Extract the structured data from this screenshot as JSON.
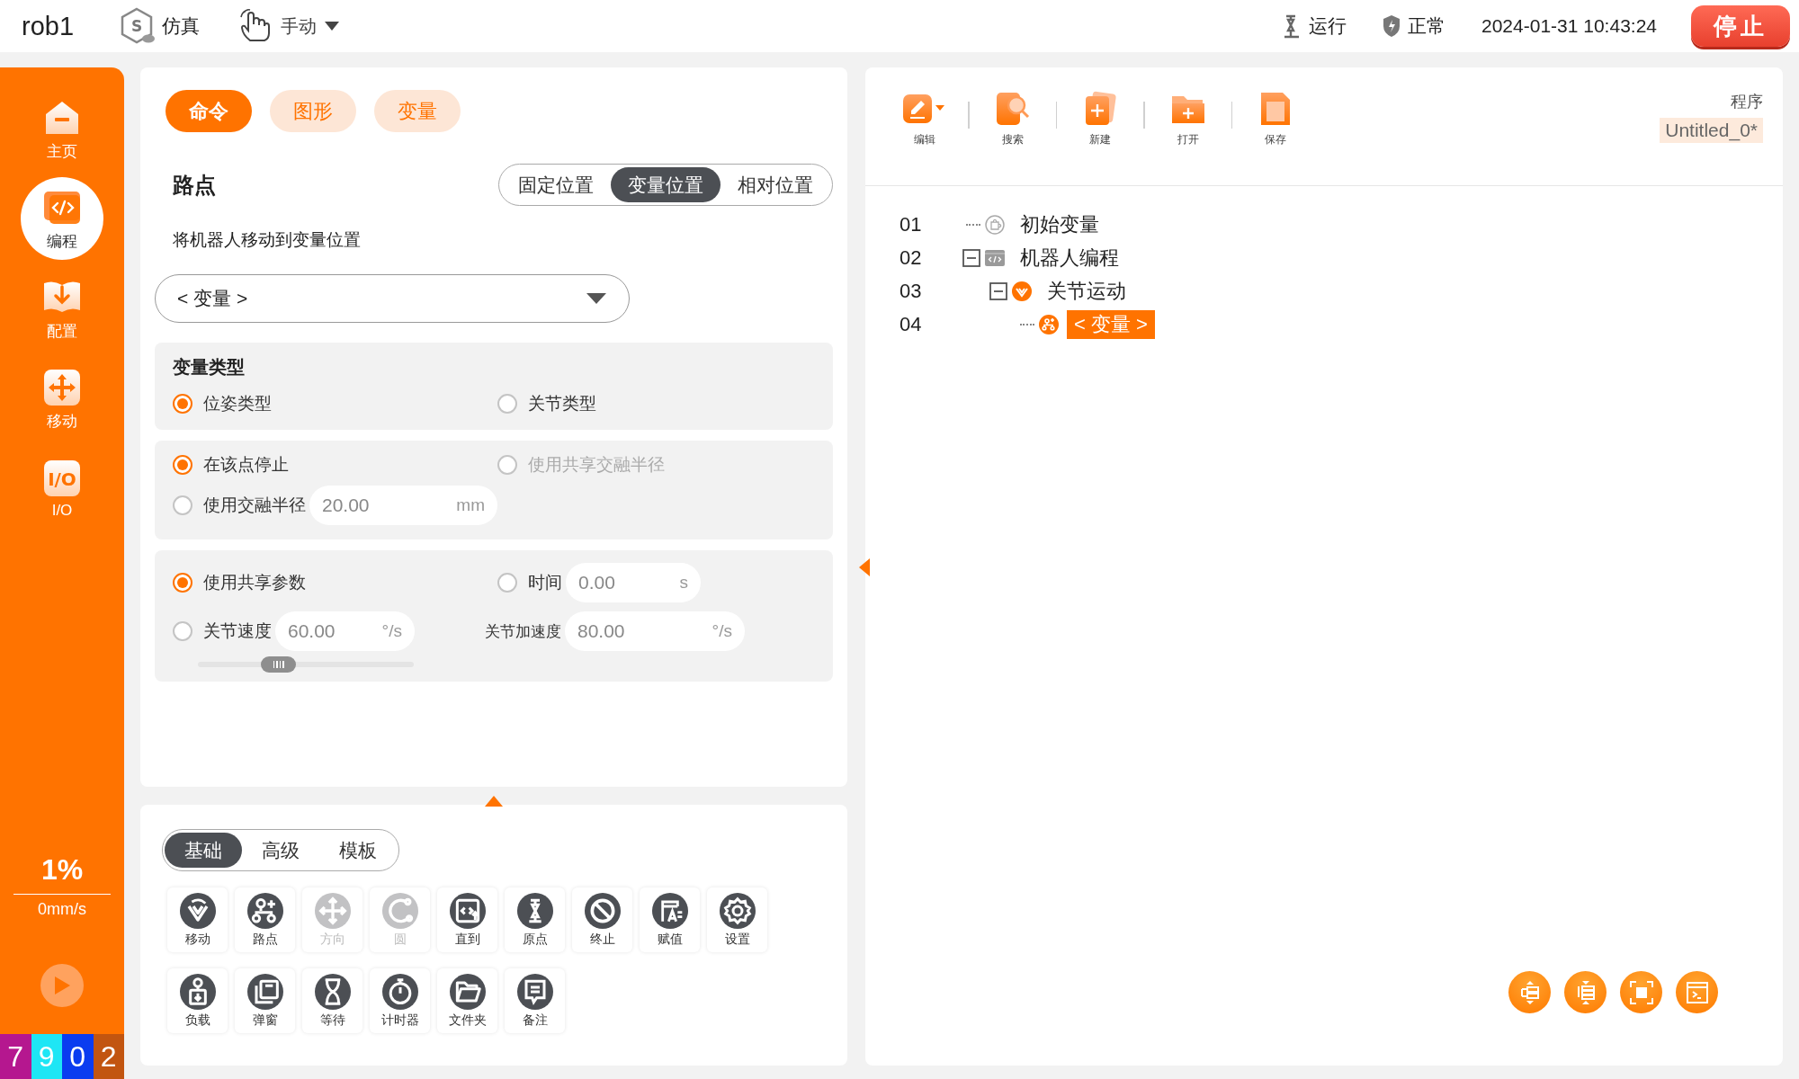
{
  "header": {
    "robot": "rob1",
    "mode": {
      "icon_text": "S",
      "label": "仿真"
    },
    "control": {
      "label": "手动"
    },
    "status": [
      {
        "kind": "robot",
        "label": "运行"
      },
      {
        "kind": "shield",
        "label": "正常"
      }
    ],
    "datetime": "2024-01-31 10:43:24",
    "stop_button": "停止"
  },
  "sidebar": {
    "items": [
      {
        "kind": "home",
        "label": "主页",
        "selected": false
      },
      {
        "kind": "code",
        "label": "编程",
        "selected": true
      },
      {
        "kind": "config",
        "label": "配置",
        "selected": false
      },
      {
        "kind": "move",
        "label": "移动",
        "selected": false
      },
      {
        "kind": "io",
        "label": "I/O",
        "icon_text": "I/O",
        "selected": false
      }
    ],
    "speed": "1%",
    "velocity": "0mm/s",
    "counters": [
      {
        "text": "7",
        "color": "#b5178f"
      },
      {
        "text": "9",
        "color": "#1ee6f5"
      },
      {
        "text": "0",
        "color": "#0a3cf0"
      },
      {
        "text": "2",
        "color": "#c25510"
      }
    ]
  },
  "command_tabs": [
    {
      "label": "命令",
      "selected": true
    },
    {
      "label": "图形",
      "selected": false
    },
    {
      "label": "变量",
      "selected": false
    }
  ],
  "waypoint": {
    "title": "路点",
    "position_tabs": [
      {
        "label": "固定位置",
        "selected": false
      },
      {
        "label": "变量位置",
        "selected": true
      },
      {
        "label": "相对位置",
        "selected": false
      }
    ],
    "description": "将机器人移动到变量位置",
    "variable_select": "< 变量 >"
  },
  "variable_type": {
    "title": "变量类型",
    "options": [
      {
        "label": "位姿类型",
        "selected": true
      },
      {
        "label": "关节类型",
        "selected": false
      }
    ]
  },
  "blend": {
    "stop": {
      "label": "在该点停止",
      "selected": true
    },
    "shared_radius": {
      "label": "使用共享交融半径",
      "selected": false,
      "disabled": true
    },
    "radius": {
      "label": "使用交融半径",
      "selected": false,
      "value": "20.00",
      "unit": "mm"
    }
  },
  "motion": {
    "shared": {
      "label": "使用共享参数",
      "selected": true
    },
    "time": {
      "label": "时间",
      "selected": false,
      "value": "0.00",
      "unit": "s"
    },
    "joint_speed": {
      "label": "关节速度",
      "selected": false,
      "value": "60.00",
      "unit": "°/s",
      "level": 0.35
    },
    "joint_accel": {
      "label": "关节加速度",
      "value": "80.00",
      "unit": "°/s"
    }
  },
  "palette": {
    "tabs": [
      {
        "label": "基础",
        "selected": true
      },
      {
        "label": "高级",
        "selected": false
      },
      {
        "label": "模板",
        "selected": false
      }
    ],
    "items": [
      {
        "label": "移动",
        "disabled": false
      },
      {
        "label": "路点",
        "disabled": false
      },
      {
        "label": "方向",
        "disabled": true
      },
      {
        "label": "圆",
        "disabled": true
      },
      {
        "label": "直到",
        "disabled": false
      },
      {
        "label": "原点",
        "disabled": false
      },
      {
        "label": "终止",
        "disabled": false
      },
      {
        "label": "赋值",
        "disabled": false
      },
      {
        "label": "设置",
        "disabled": false
      },
      {
        "label": "负载",
        "disabled": false
      },
      {
        "label": "弹窗",
        "disabled": false
      },
      {
        "label": "等待",
        "disabled": false
      },
      {
        "label": "计时器",
        "disabled": false
      },
      {
        "label": "文件夹",
        "disabled": false
      },
      {
        "label": "备注",
        "disabled": false
      }
    ]
  },
  "program": {
    "toolbar": [
      {
        "kind": "edit",
        "label": "编辑"
      },
      {
        "kind": "search",
        "label": "搜索"
      },
      {
        "kind": "new",
        "label": "新建"
      },
      {
        "kind": "open",
        "label": "打开"
      },
      {
        "kind": "save",
        "label": "保存"
      }
    ],
    "program_label": "程序",
    "program_name": "Untitled_0*",
    "tree": [
      {
        "line": "01",
        "kind": "init",
        "label": "初始变量"
      },
      {
        "line": "02",
        "kind": "program",
        "label": "机器人编程",
        "expanded": true,
        "children": [
          {
            "line": "03",
            "kind": "joint_move",
            "label": "关节运动",
            "expanded": true,
            "children": [
              {
                "line": "04",
                "kind": "waypoint",
                "label": "< 变量 >",
                "selected": true
              }
            ]
          }
        ]
      }
    ]
  }
}
